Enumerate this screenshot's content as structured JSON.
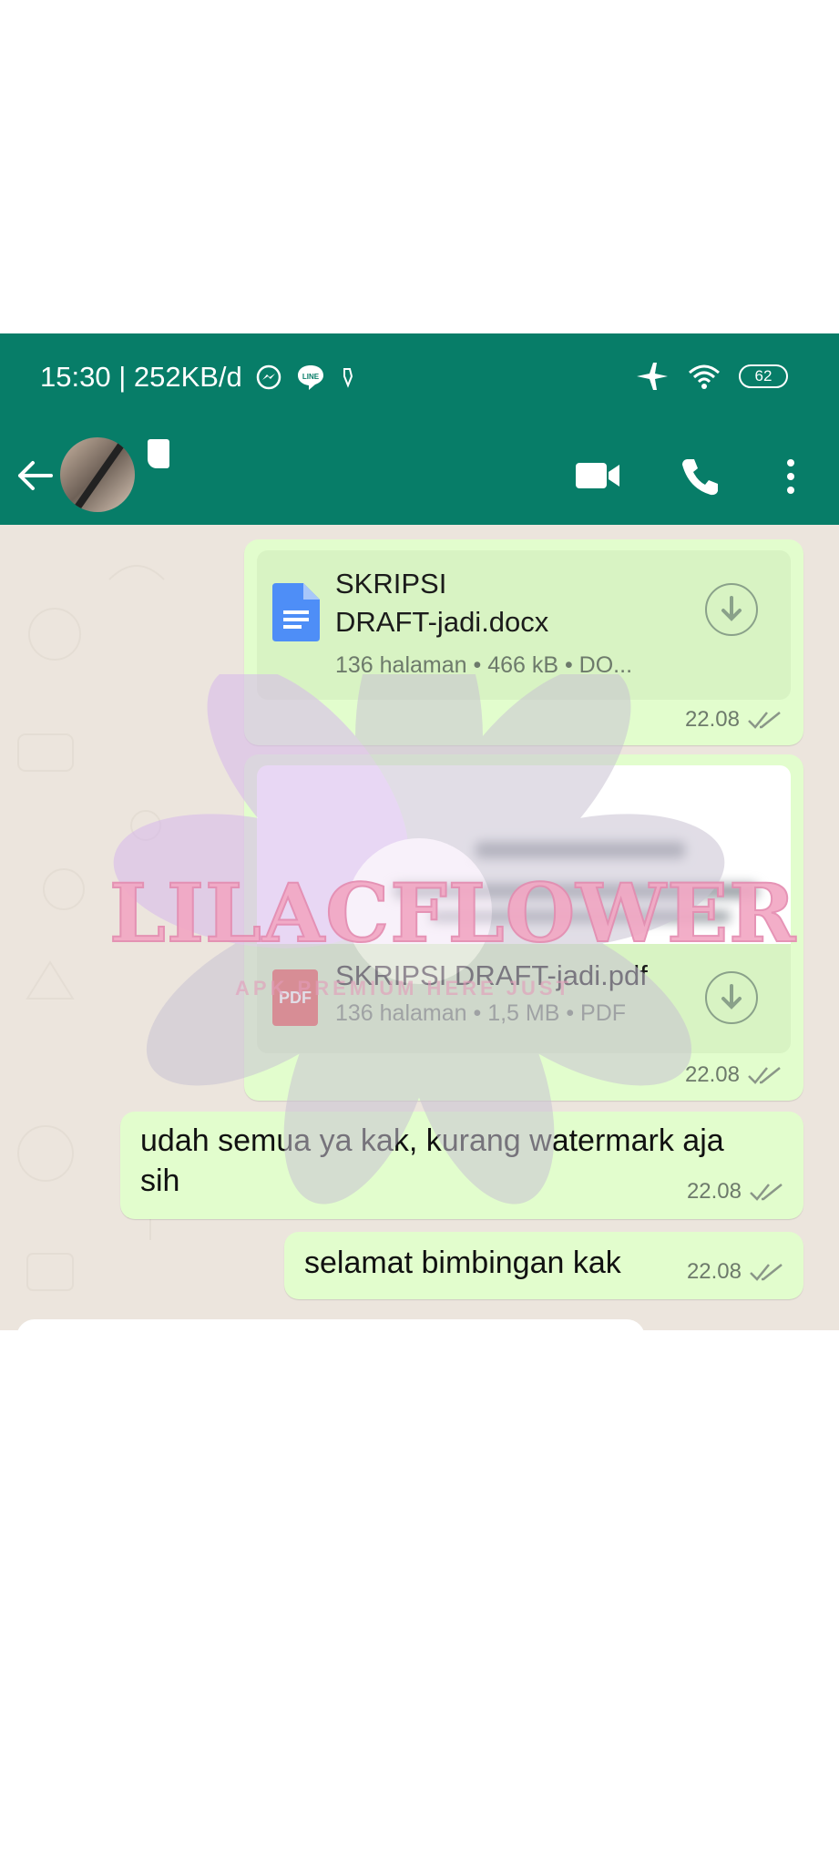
{
  "status": {
    "time_speed": "15:30 | 252KB/d",
    "battery": "62"
  },
  "header": {
    "contact_name": ""
  },
  "messages": [
    {
      "type": "document",
      "name_line1": "SKRIPSI",
      "name_line2": "DRAFT-jadi.docx",
      "meta": "136 halaman • 466 kB • DO...",
      "time": "22.08"
    },
    {
      "type": "document",
      "name": "SKRIPSI DRAFT-jadi.pdf",
      "meta": "136 halaman • 1,5 MB • PDF",
      "icon_label": "PDF",
      "time": "22.08"
    },
    {
      "type": "text",
      "line1": "udah semua ya kak, kurang watermark aja",
      "line2": "sih",
      "time": "22.08"
    },
    {
      "type": "text",
      "text": "selamat bimbingan kak",
      "time": "22.08"
    }
  ],
  "watermark": {
    "text": "LILACFLOWER",
    "sub": "APK PREMIUM HERE JUST"
  },
  "colors": {
    "header": "#077d68",
    "bubble": "#e2fdcd",
    "chat_bg": "#ece5dd"
  }
}
